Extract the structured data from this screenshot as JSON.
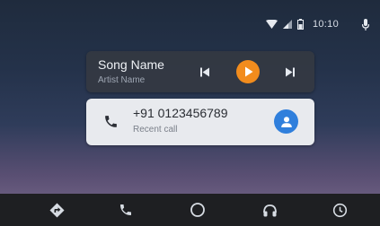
{
  "status_bar": {
    "time": "10:10",
    "icons": [
      "wifi-icon",
      "signal-icon",
      "battery-icon",
      "microphone-icon"
    ]
  },
  "media": {
    "song_title": "Song Name",
    "artist": "Artist Name",
    "accent_color": "#f28c1d",
    "controls": [
      "skip-previous-icon",
      "play-icon",
      "skip-next-icon"
    ]
  },
  "call": {
    "number": "+91 0123456789",
    "type": "Recent call",
    "avatar_color": "#2f7fdc"
  },
  "nav": {
    "items": [
      "navigation-icon",
      "phone-icon",
      "home-icon",
      "headphones-icon",
      "recents-icon"
    ]
  }
}
